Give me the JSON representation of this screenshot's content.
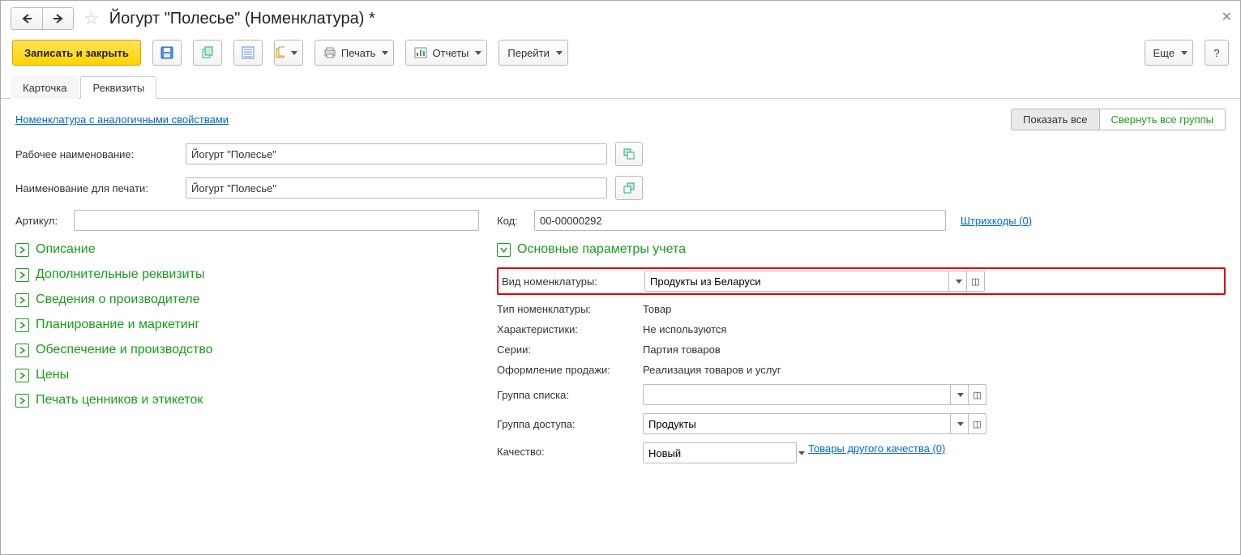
{
  "title": "Йогурт \"Полесье\" (Номенклатура) *",
  "toolbar": {
    "save_close": "Записать и закрыть",
    "print": "Печать",
    "reports": "Отчеты",
    "goto": "Перейти",
    "more": "Еще",
    "help": "?"
  },
  "tabs": {
    "card": "Карточка",
    "requisites": "Реквизиты"
  },
  "top": {
    "analog_link": "Номенклатура с аналогичными свойствами",
    "show_all": "Показать все",
    "collapse_all": "Свернуть все группы"
  },
  "fields": {
    "work_name_label": "Рабочее наименование:",
    "work_name_value": "Йогурт \"Полесье\"",
    "print_name_label": "Наименование для печати:",
    "print_name_value": "Йогурт \"Полесье\"",
    "sku_label": "Артикул:",
    "sku_value": "",
    "code_label": "Код:",
    "code_value": "00-00000292",
    "barcodes_link": "Штрихкоды (0)"
  },
  "leftGroups": [
    "Описание",
    "Дополнительные реквизиты",
    "Сведения о производителе",
    "Планирование и маркетинг",
    "Обеспечение и производство",
    "Цены",
    "Печать ценников и этикеток"
  ],
  "right": {
    "main_params": "Основные параметры учета",
    "kind_label": "Вид номенклатуры:",
    "kind_value": "Продукты из Беларуси",
    "type_label": "Тип номенклатуры:",
    "type_value": "Товар",
    "char_label": "Характеристики:",
    "char_value": "Не используются",
    "series_label": "Серии:",
    "series_value": "Партия товаров",
    "sale_label": "Оформление продажи:",
    "sale_value": "Реализация товаров и услуг",
    "group_list_label": "Группа списка:",
    "group_list_value": "",
    "group_access_label": "Группа доступа:",
    "group_access_value": "Продукты",
    "quality_label": "Качество:",
    "quality_value": "Новый",
    "other_quality_link": "Товары другого качества (0)"
  }
}
